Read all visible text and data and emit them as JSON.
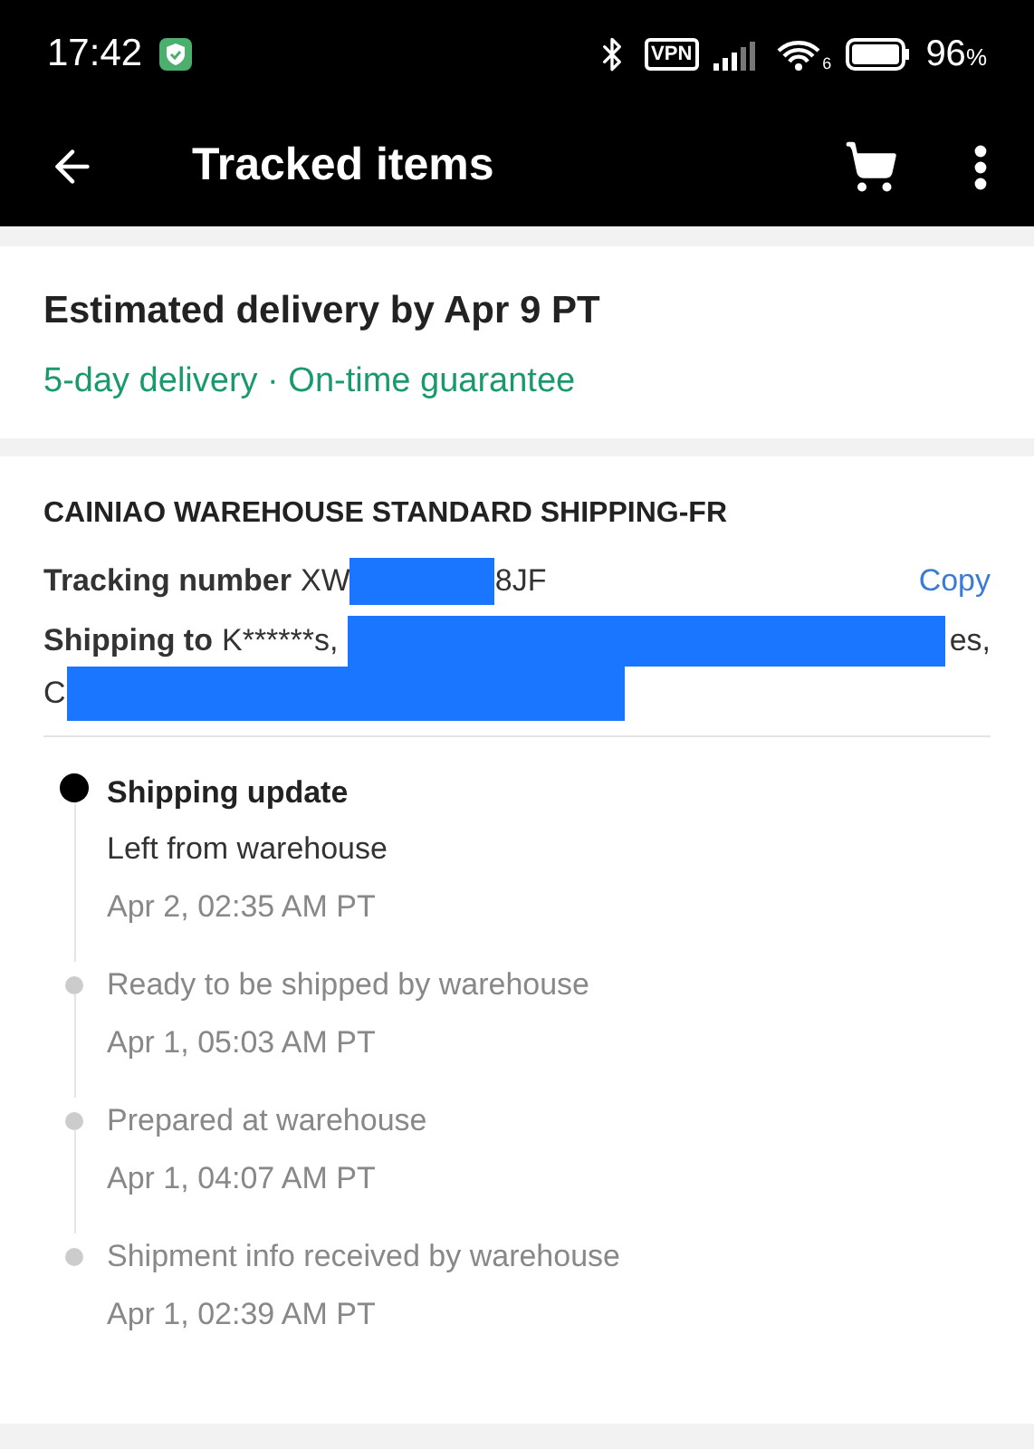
{
  "status_bar": {
    "time": "17:42",
    "vpn": "VPN",
    "network": "6",
    "battery": "96",
    "battery_unit": "%"
  },
  "app_bar": {
    "title": "Tracked items"
  },
  "delivery": {
    "title": "Estimated delivery by Apr 9 PT",
    "subtitle": "5-day delivery · On-time guarantee"
  },
  "shipment": {
    "carrier": "CAINIAO WAREHOUSE STANDARD SHIPPING-FR",
    "tracking_label": "Tracking number",
    "tracking_start": "XW",
    "tracking_end": "8JF",
    "copy": "Copy",
    "shipping_label": "Shipping to",
    "address_start": "K******s,",
    "address_end": "es,",
    "address_line2": "C"
  },
  "events": [
    {
      "current": true,
      "title": "Shipping update",
      "description": "Left from warehouse",
      "time": "Apr 2, 02:35 AM PT"
    },
    {
      "current": false,
      "description": "Ready to be shipped by warehouse",
      "time": "Apr 1, 05:03 AM PT"
    },
    {
      "current": false,
      "description": "Prepared at warehouse",
      "time": "Apr 1, 04:07 AM PT"
    },
    {
      "current": false,
      "description": "Shipment info received by warehouse",
      "time": "Apr 1, 02:39 AM PT"
    }
  ]
}
